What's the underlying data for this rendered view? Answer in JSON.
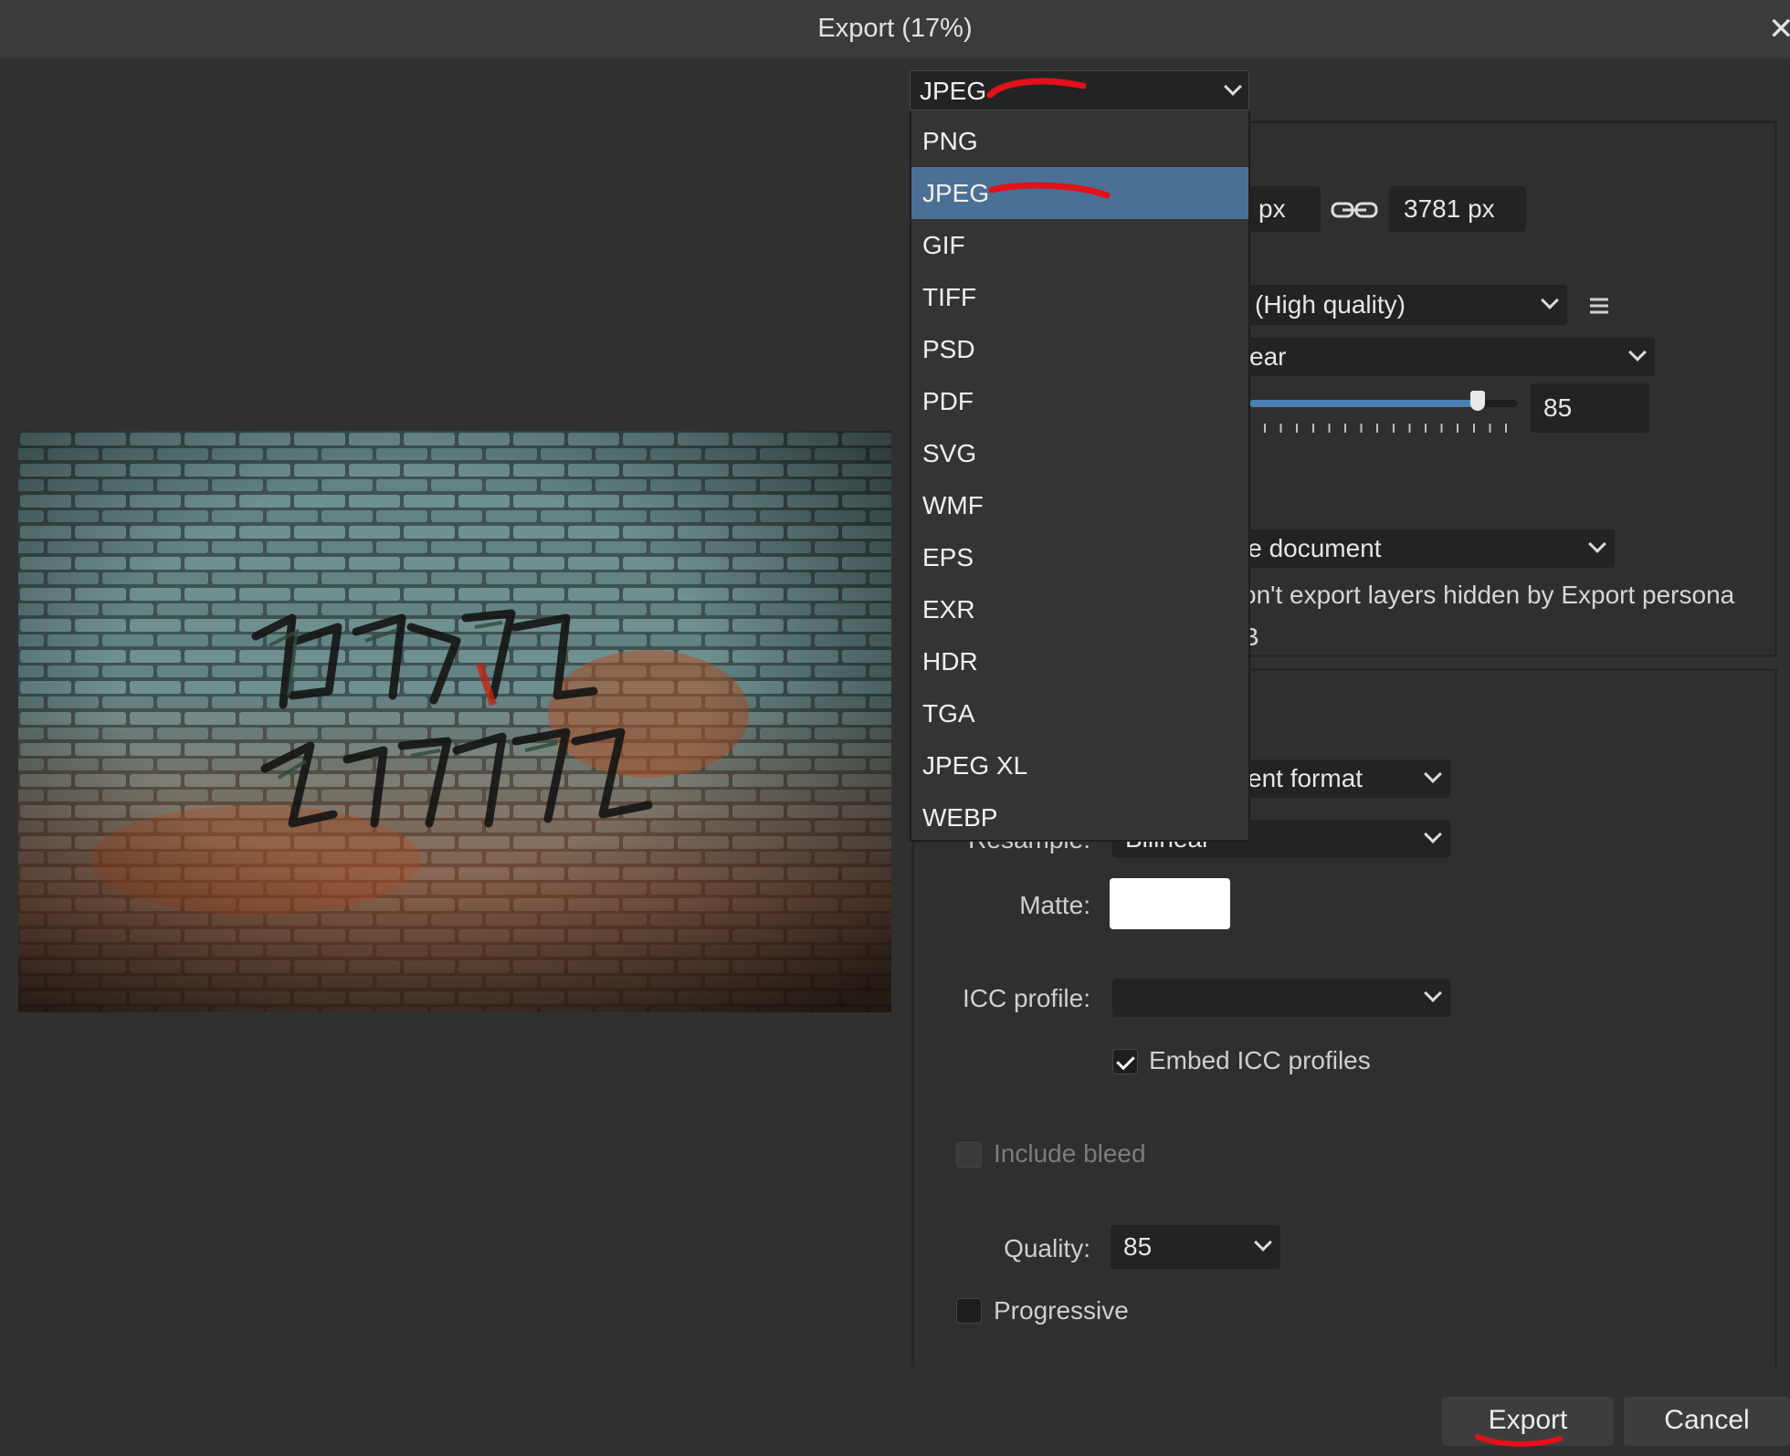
{
  "window": {
    "title": "Export (17%)",
    "close_glyph": "✕"
  },
  "format_select": {
    "value": "JPEG"
  },
  "format_menu": {
    "items": [
      "PNG",
      "JPEG",
      "GIF",
      "TIFF",
      "PSD",
      "PDF",
      "SVG",
      "WMF",
      "EPS",
      "EXR",
      "HDR",
      "TGA",
      "JPEG XL",
      "WEBP"
    ],
    "selected": "JPEG"
  },
  "size": {
    "width_unit": "px",
    "height_value": "3781 px"
  },
  "preset": {
    "value": "(High quality)"
  },
  "resample_top": {
    "value": "ear"
  },
  "quality_top": {
    "value": "85",
    "slider_level": 0.85
  },
  "area": {
    "value": "le document"
  },
  "hidden_layers_note": "on't export layers hidden by Export persona",
  "size_note": "B",
  "advanced": {
    "pixel_format": {
      "value": "ent format"
    },
    "resample": {
      "label": "Resample:",
      "value": "Bilinear"
    },
    "matte": {
      "label": "Matte:",
      "color": "#ffffff"
    },
    "icc_profile": {
      "label": "ICC profile:",
      "value": ""
    },
    "embed_icc": {
      "label": "Embed ICC profiles",
      "checked": true
    },
    "include_bleed": {
      "label": "Include bleed",
      "checked": false,
      "enabled": false
    },
    "quality": {
      "label": "Quality:",
      "value": "85"
    },
    "progressive": {
      "label": "Progressive",
      "checked": false
    }
  },
  "buttons": {
    "export": "Export",
    "cancel": "Cancel"
  },
  "colors": {
    "selection": "#4b7096",
    "slider": "#4d7fb3",
    "annotation": "#e0121b"
  }
}
